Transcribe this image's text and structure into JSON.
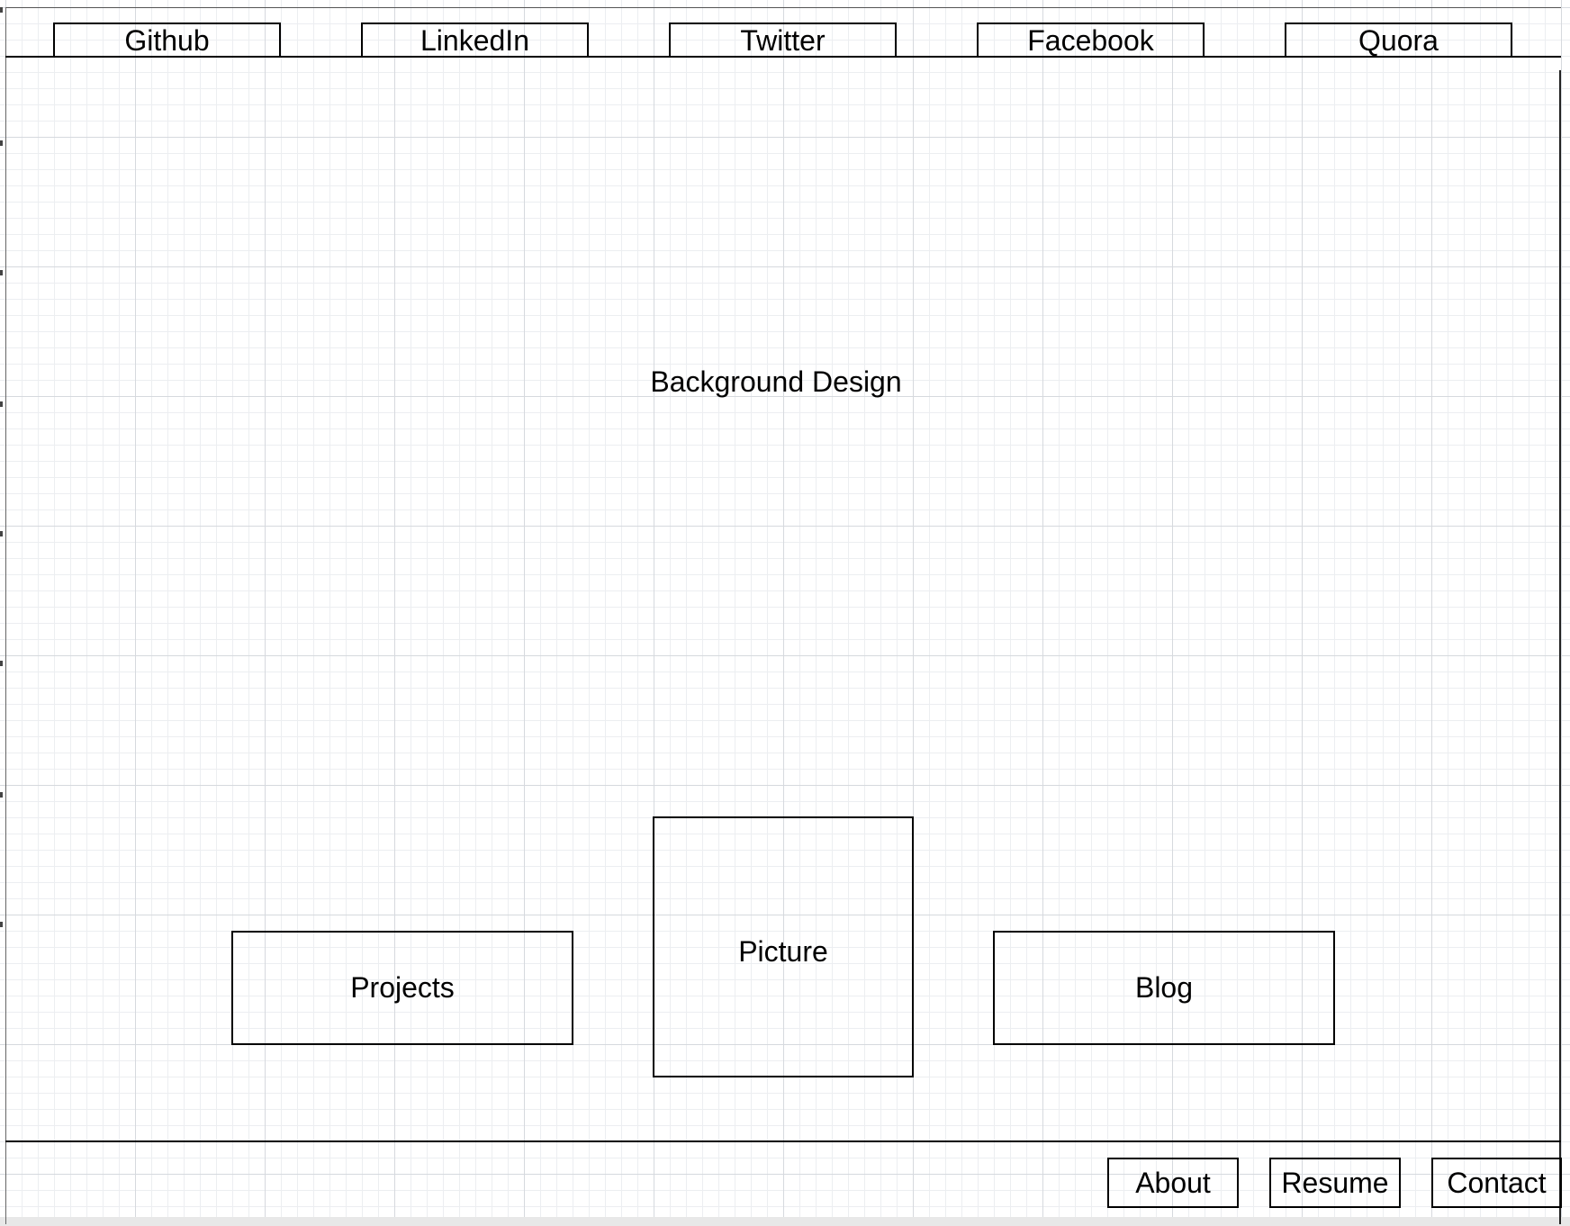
{
  "header": {
    "links": [
      {
        "id": "github",
        "label": "Github"
      },
      {
        "id": "linkedin",
        "label": "LinkedIn"
      },
      {
        "id": "twitter",
        "label": "Twitter"
      },
      {
        "id": "facebook",
        "label": "Facebook"
      },
      {
        "id": "quora",
        "label": "Quora"
      }
    ]
  },
  "main": {
    "background_label": "Background Design",
    "projects_label": "Projects",
    "picture_label": "Picture",
    "blog_label": "Blog"
  },
  "footer": {
    "links": [
      {
        "id": "about",
        "label": "About"
      },
      {
        "id": "resume",
        "label": "Resume"
      },
      {
        "id": "contact",
        "label": "Contact"
      }
    ]
  },
  "colors": {
    "grid_major": "#d6d9de",
    "grid_minor": "#eceef1",
    "stroke": "#000000",
    "background": "#ffffff"
  }
}
